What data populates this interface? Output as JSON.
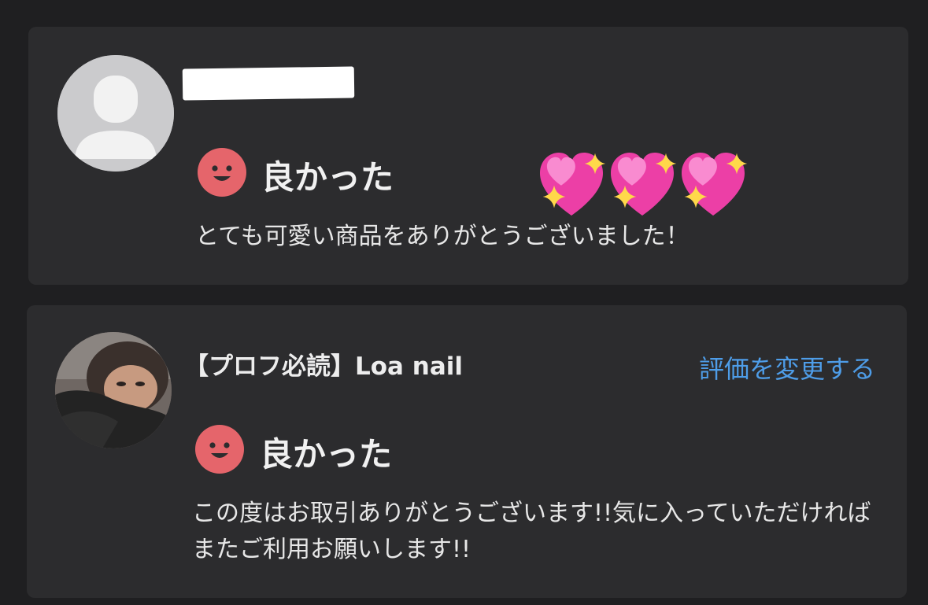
{
  "reviews": [
    {
      "user_name": "",
      "name_redacted": true,
      "rating": "良かった",
      "comment": "とても可愛い商品をありがとうございました！",
      "emoji": "sparkling-heart x3"
    },
    {
      "user_name": "【プロフ必読】Loa nail",
      "name_redacted": false,
      "rating": "良かった",
      "comment": "この度はお取引ありがとうございます!!気に入っていただければまたご利用お願いします!!",
      "action_link": "評価を変更する"
    }
  ],
  "colors": {
    "background": "#1f1f21",
    "card": "#2c2c2e",
    "rating_face": "#e5656b",
    "link": "#4e9de8",
    "heart": "#ec3fa6",
    "sparkle": "#ffd84a"
  }
}
